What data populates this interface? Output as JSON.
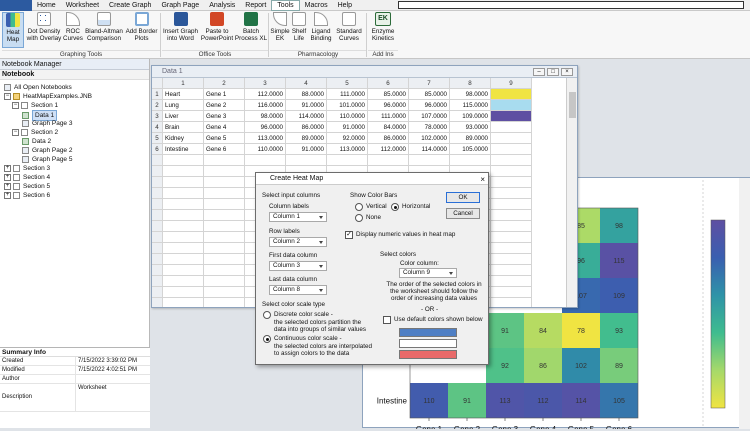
{
  "menubar": {
    "app_label": "",
    "items": [
      "Home",
      "Worksheet",
      "Create Graph",
      "Graph Page",
      "Analysis",
      "Report",
      "Tools",
      "Macros",
      "Help"
    ],
    "active": "Tools"
  },
  "ribbon": {
    "buttons": [
      {
        "label": "Heat\nMap",
        "icon": "heat-map-icon"
      },
      {
        "label": "Dot Density\nwith Overlay",
        "icon": "dot-density-icon"
      },
      {
        "label": "ROC\nCurves",
        "icon": "roc-curve-icon"
      },
      {
        "label": "Bland-Altman\nComparison",
        "icon": "bland-altman-icon"
      },
      {
        "label": "Add Border\nPlots",
        "icon": "border-plot-icon"
      },
      {
        "label": "Insert Graph\ninto Word",
        "icon": "word-icon"
      },
      {
        "label": "Paste to\nPowerPoint",
        "icon": "powerpoint-icon"
      },
      {
        "label": "Batch\nProcess XL",
        "icon": "excel-icon"
      },
      {
        "label": "Simple\nEK",
        "icon": "simple-ek-icon"
      },
      {
        "label": "Shelf\nLife",
        "icon": "shelf-life-icon"
      },
      {
        "label": "Ligand\nBinding",
        "icon": "ligand-icon"
      },
      {
        "label": "Standard\nCurves",
        "icon": "standard-curve-icon"
      },
      {
        "label": "Enzyme\nKinetics",
        "icon": "enzyme-kinetics-icon",
        "badge": "EK"
      }
    ],
    "groups": [
      "Graphing Tools",
      "Office Tools",
      "Pharmacology",
      "Add Ins"
    ]
  },
  "notebook": {
    "title": "Notebook Manager",
    "panel_label": "Notebook",
    "root": "All Open Notebooks",
    "file": "HeatMapExamples.JNB",
    "tree": [
      {
        "label": "Section 1",
        "kind": "section",
        "level": 2,
        "expanded": true
      },
      {
        "label": "Data 1",
        "kind": "sheet",
        "level": 3,
        "selected": true
      },
      {
        "label": "Graph Page 3",
        "kind": "page",
        "level": 3
      },
      {
        "label": "Section 2",
        "kind": "section",
        "level": 2,
        "expanded": true
      },
      {
        "label": "Data 2",
        "kind": "sheet",
        "level": 3
      },
      {
        "label": "Graph Page 2",
        "kind": "page",
        "level": 3
      },
      {
        "label": "Graph Page 5",
        "kind": "page",
        "level": 3
      },
      {
        "label": "Section 3",
        "kind": "section",
        "level": 1
      },
      {
        "label": "Section 4",
        "kind": "section",
        "level": 1
      },
      {
        "label": "Section 5",
        "kind": "section",
        "level": 1
      },
      {
        "label": "Section 6",
        "kind": "section",
        "level": 1
      }
    ]
  },
  "summary": {
    "title": "Summary Info",
    "rows": [
      {
        "key": "Created",
        "value": "7/15/2022 3:39:02 PM"
      },
      {
        "key": "Modified",
        "value": "7/15/2022 4:02:51 PM"
      },
      {
        "key": "Author",
        "value": ""
      },
      {
        "key": "Description",
        "value": "Worksheet"
      }
    ]
  },
  "worksheet": {
    "title": "Data 1",
    "col_headers": [
      "1",
      "2",
      "3",
      "4",
      "5",
      "6",
      "7",
      "8",
      "9"
    ],
    "rows": [
      [
        "Heart",
        "Gene 1",
        "112.0000",
        "88.0000",
        "111.0000",
        "85.0000",
        "85.0000",
        "98.0000",
        ""
      ],
      [
        "Lung",
        "Gene 2",
        "116.0000",
        "91.0000",
        "101.0000",
        "96.0000",
        "96.0000",
        "115.0000",
        ""
      ],
      [
        "Liver",
        "Gene 3",
        "98.0000",
        "114.0000",
        "110.0000",
        "111.0000",
        "107.0000",
        "109.0000",
        ""
      ],
      [
        "Brain",
        "Gene 4",
        "96.0000",
        "86.0000",
        "91.0000",
        "84.0000",
        "78.0000",
        "93.0000",
        ""
      ],
      [
        "Kidney",
        "Gene 5",
        "113.0000",
        "89.0000",
        "92.0000",
        "86.0000",
        "102.0000",
        "89.0000",
        ""
      ],
      [
        "Intestine",
        "Gene 6",
        "110.0000",
        "91.0000",
        "113.0000",
        "112.0000",
        "114.0000",
        "105.0000",
        ""
      ]
    ],
    "color_column": [
      "#f0e442",
      "#a8dcef",
      "#5e4fa2"
    ]
  },
  "dialog": {
    "title": "Create Heat Map",
    "select_input_label": "Select input columns",
    "column_labels_label": "Column labels",
    "column_labels_value": "Column 1",
    "row_labels_label": "Row labels",
    "row_labels_value": "Column 2",
    "first_data_label": "First data column",
    "first_data_value": "Column 3",
    "last_data_label": "Last data column",
    "last_data_value": "Column 8",
    "show_bars_label": "Show Color Bars",
    "opt_vertical": "Vertical",
    "opt_horizontal": "Horizontal",
    "opt_none": "None",
    "display_numeric": "Display numeric values in heat map",
    "select_colors_label": "Select colors",
    "color_column_label": "Color column:",
    "color_column_value": "Column 9",
    "order_note": "The order of the selected colors in the worksheet should follow the order of increasing data values",
    "or_label": "- OR -",
    "use_default": "Use default colors shown below",
    "scale_type_label": "Select color scale type",
    "discrete_label": "Discrete color scale -",
    "discrete_desc": "the selected colors partition the data into groups of similar values",
    "continuous_label": "Continuous color scale -",
    "continuous_desc": "the selected colors are interpolated to assign colors to the data",
    "ok": "OK",
    "cancel": "Cancel",
    "default_swatches": [
      "#4f7fc4",
      "#ffffff",
      "#e86a6a"
    ]
  },
  "heatmap": {
    "genes": [
      "Gene 1",
      "Gene 2",
      "Gene 3",
      "Gene 4",
      "Gene 5",
      "Gene 6"
    ],
    "row_label": "Intestine",
    "rows": [
      [
        null,
        null,
        null,
        null,
        85,
        98
      ],
      [
        null,
        null,
        null,
        null,
        96,
        115
      ],
      [
        null,
        null,
        null,
        null,
        107,
        109
      ],
      [
        null,
        null,
        91,
        84,
        78,
        93
      ],
      [
        null,
        null,
        92,
        86,
        102,
        89
      ],
      [
        110,
        91,
        113,
        112,
        114,
        105
      ]
    ],
    "min": 78,
    "max": 116,
    "gradient": [
      "#f0e442",
      "#a6d96a",
      "#3fbc8f",
      "#2e93a8",
      "#3a5fb0",
      "#5e4fa2"
    ]
  }
}
